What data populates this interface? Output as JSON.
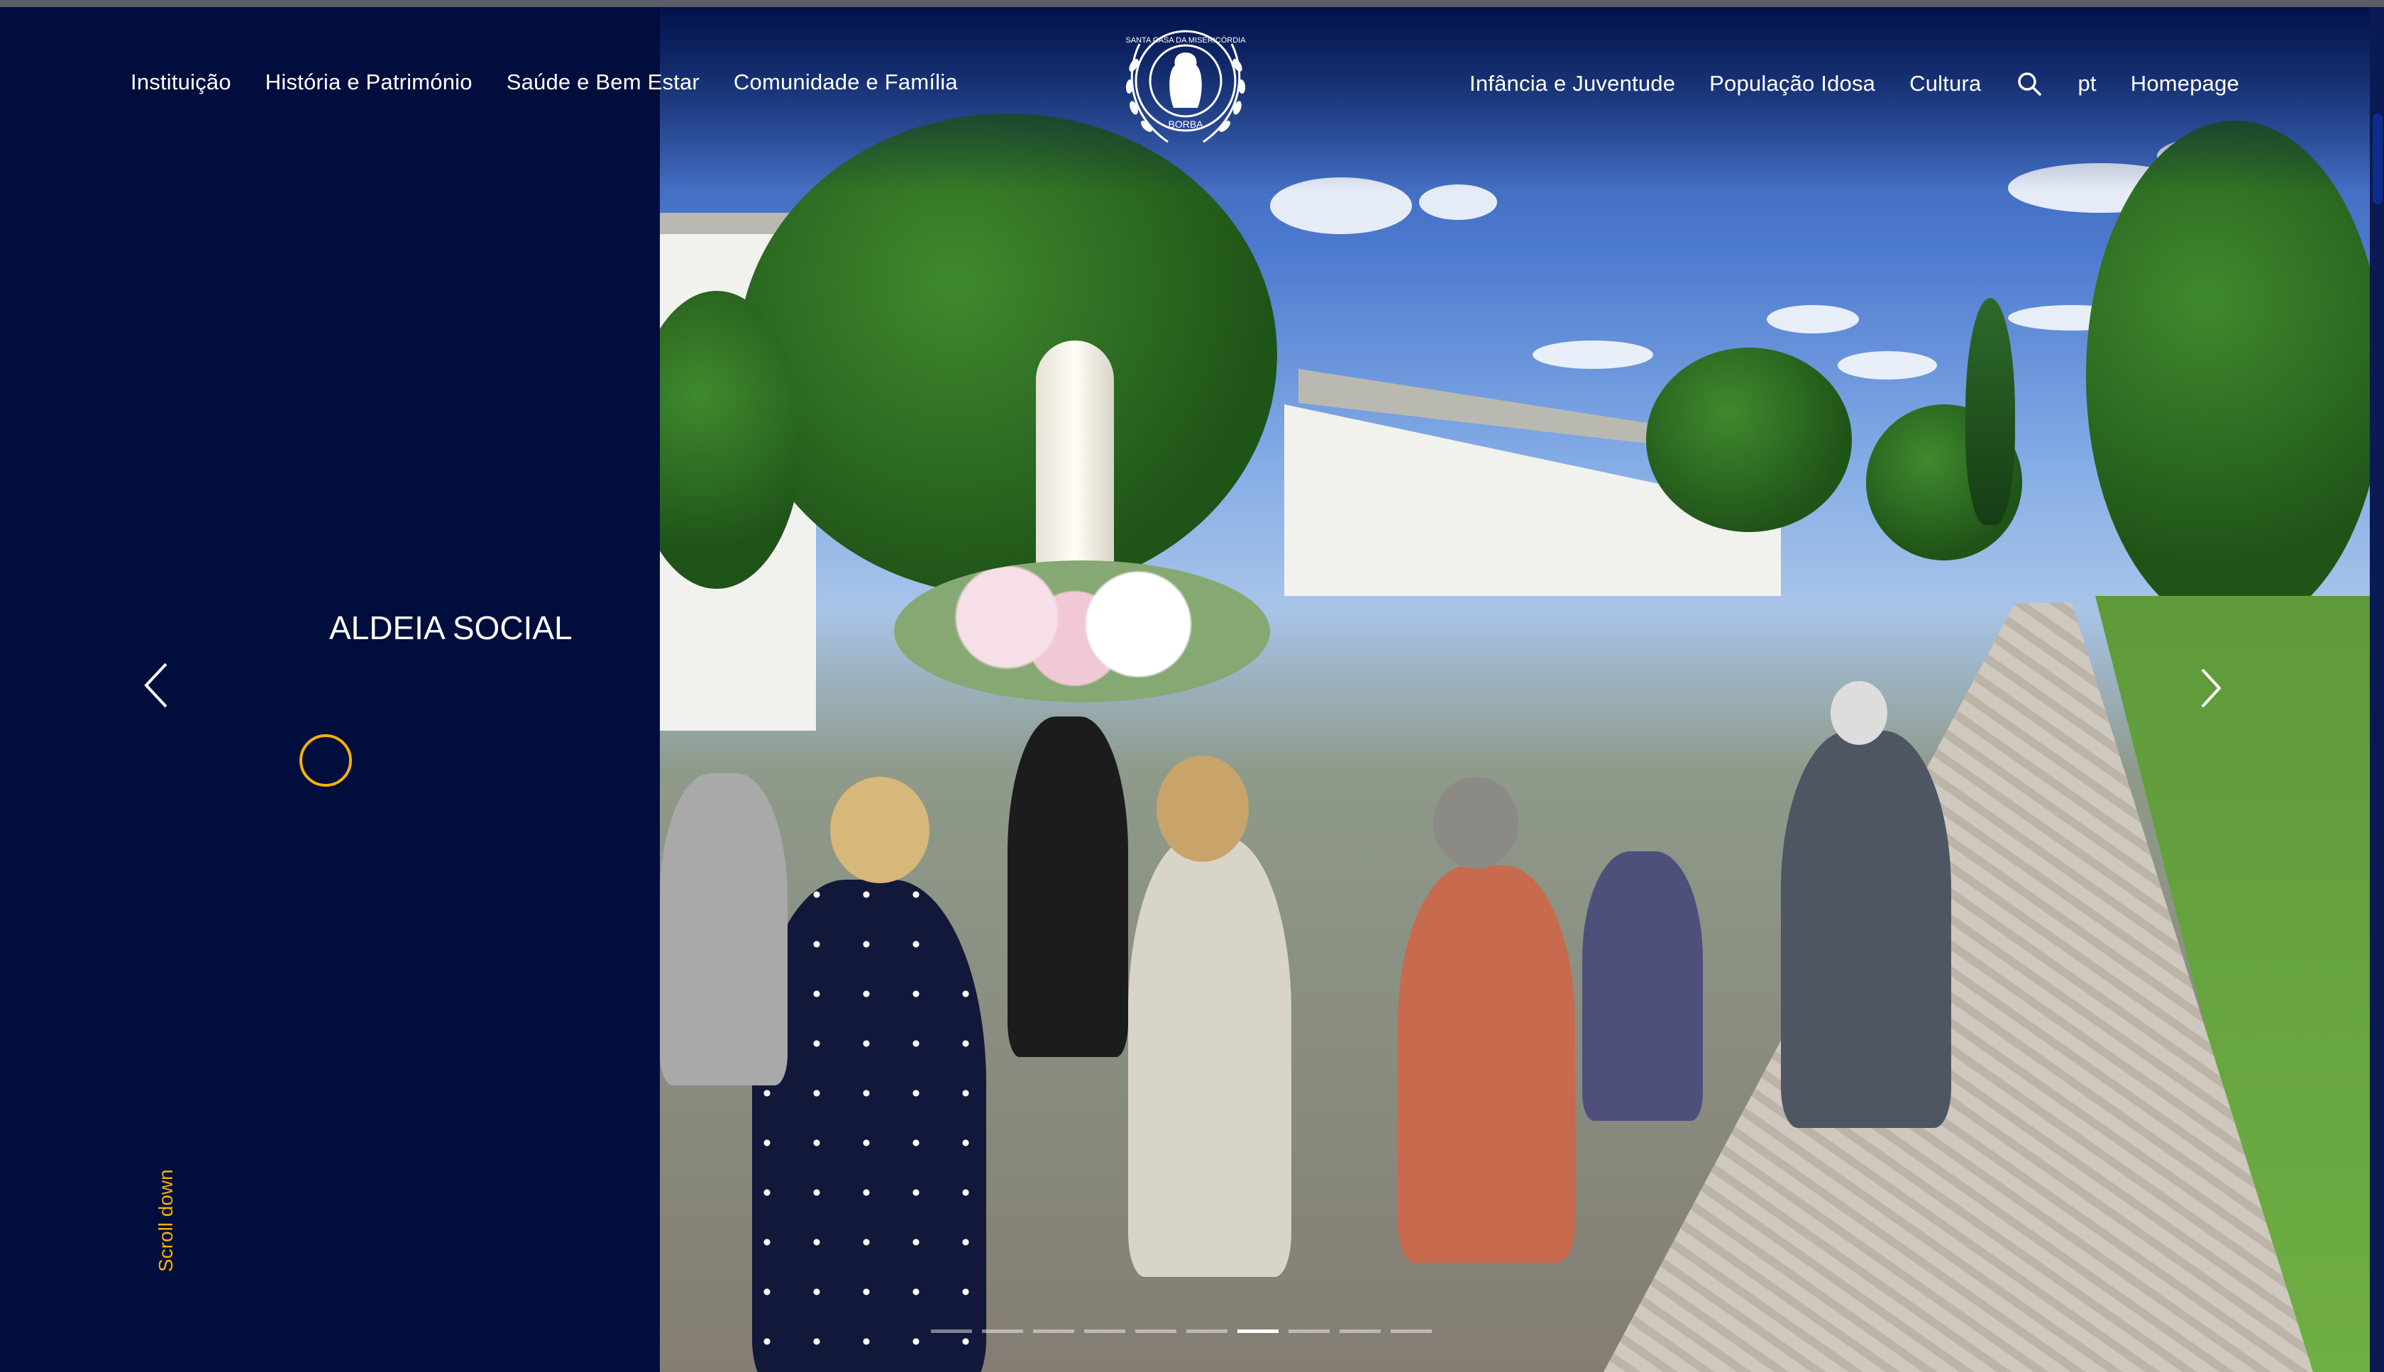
{
  "nav": {
    "left": [
      "Instituição",
      "História e Património",
      "Saúde e Bem Estar",
      "Comunidade e Família"
    ],
    "right": [
      "Infância e Juventude",
      "População Idosa",
      "Cultura"
    ],
    "language": "pt",
    "homepage": "Homepage"
  },
  "logo": {
    "top_text": "SANTA CASA DA MISERICÓRDIA",
    "bottom_text": "BORBA"
  },
  "slider": {
    "title": "ALDEIA SOCIAL",
    "dot_count": 10,
    "active_index": 6
  },
  "scroll_label": "Scroll down",
  "colors": {
    "panel": "#000d3d",
    "accent": "#f5b300",
    "text": "#ffffff"
  },
  "icons": [
    "search-icon",
    "chevron-left-icon",
    "chevron-right-icon"
  ]
}
